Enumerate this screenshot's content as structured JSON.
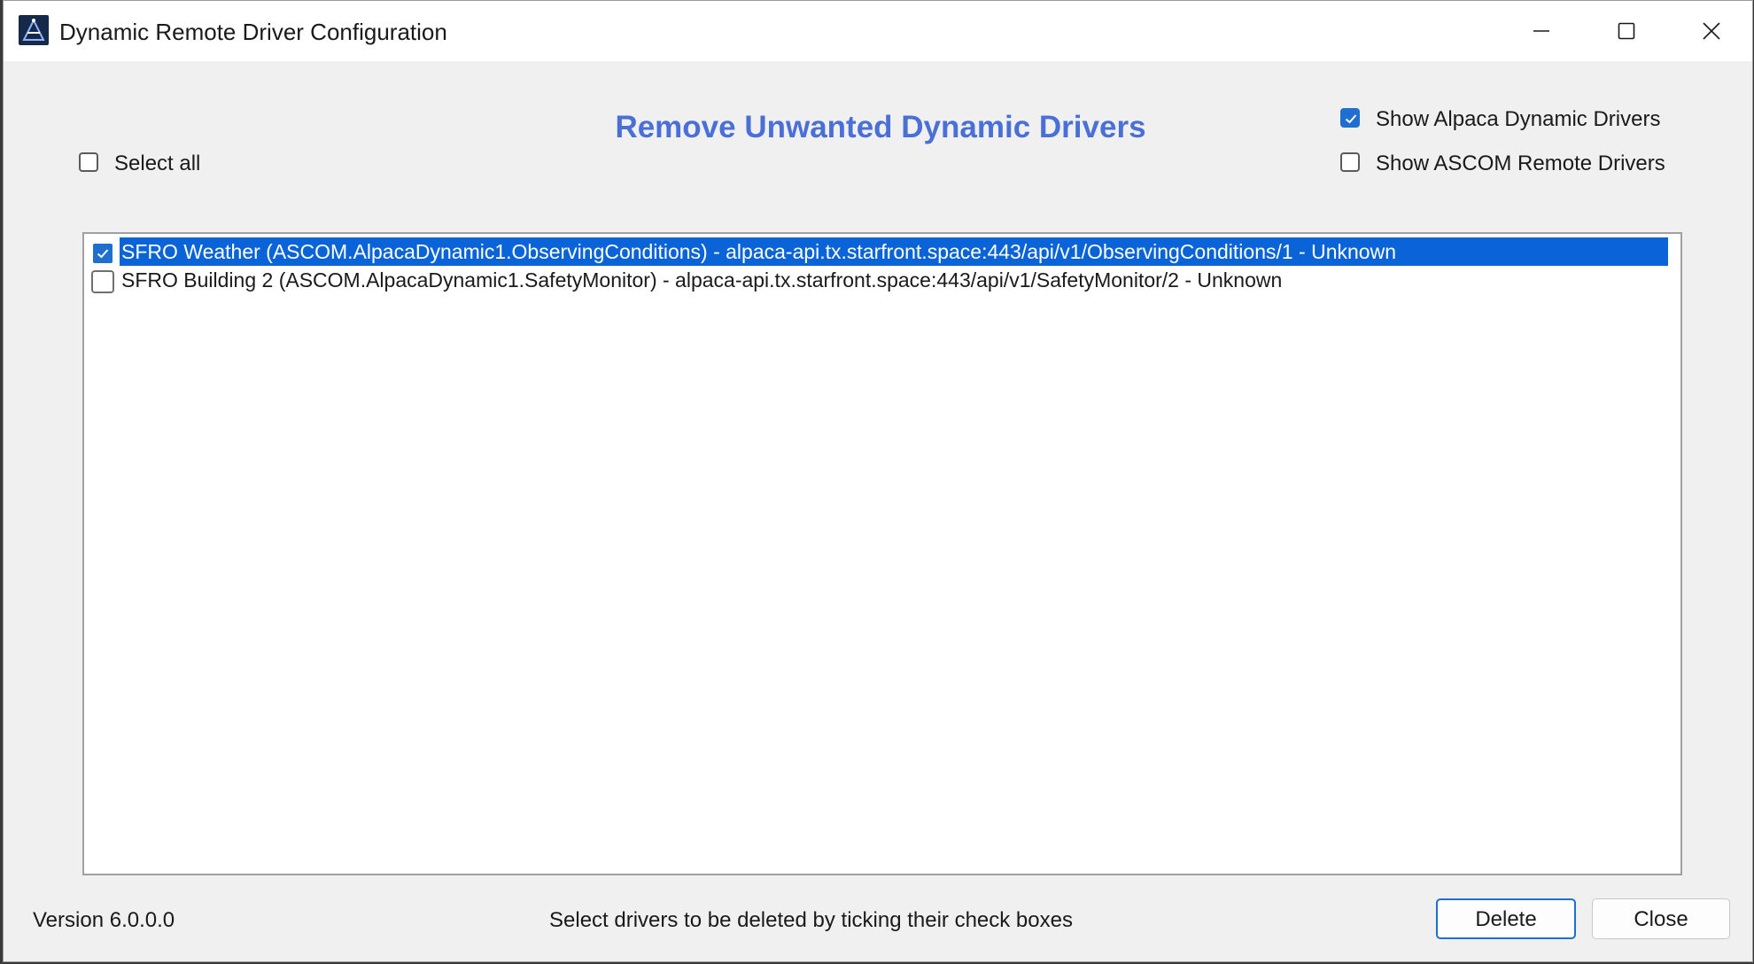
{
  "window": {
    "title": "Dynamic Remote Driver Configuration"
  },
  "heading": "Remove Unwanted Dynamic Drivers",
  "select_all_label": "Select all",
  "options": {
    "show_alpaca_label": "Show Alpaca Dynamic Drivers",
    "show_alpaca_checked": true,
    "show_ascom_label": "Show ASCOM Remote Drivers",
    "show_ascom_checked": false
  },
  "drivers": [
    {
      "text": "SFRO Weather (ASCOM.AlpacaDynamic1.ObservingConditions) - alpaca-api.tx.starfront.space:443/api/v1/ObservingConditions/1 - Unknown",
      "checked": true,
      "selected": true
    },
    {
      "text": "SFRO Building 2 (ASCOM.AlpacaDynamic1.SafetyMonitor) - alpaca-api.tx.starfront.space:443/api/v1/SafetyMonitor/2 - Unknown",
      "checked": false,
      "selected": false
    }
  ],
  "footer": {
    "version": "Version 6.0.0.0",
    "hint": "Select drivers to be deleted by ticking their check boxes",
    "delete_label": "Delete",
    "close_label": "Close"
  },
  "colors": {
    "heading": "#4a6fd6",
    "selection": "#0a64d8",
    "checkbox_accent": "#1f6fd1"
  },
  "icons": {
    "app": "ascom-app-icon",
    "minimize": "minimize-icon",
    "maximize": "maximize-icon",
    "close": "close-icon",
    "check": "checkmark-icon"
  }
}
